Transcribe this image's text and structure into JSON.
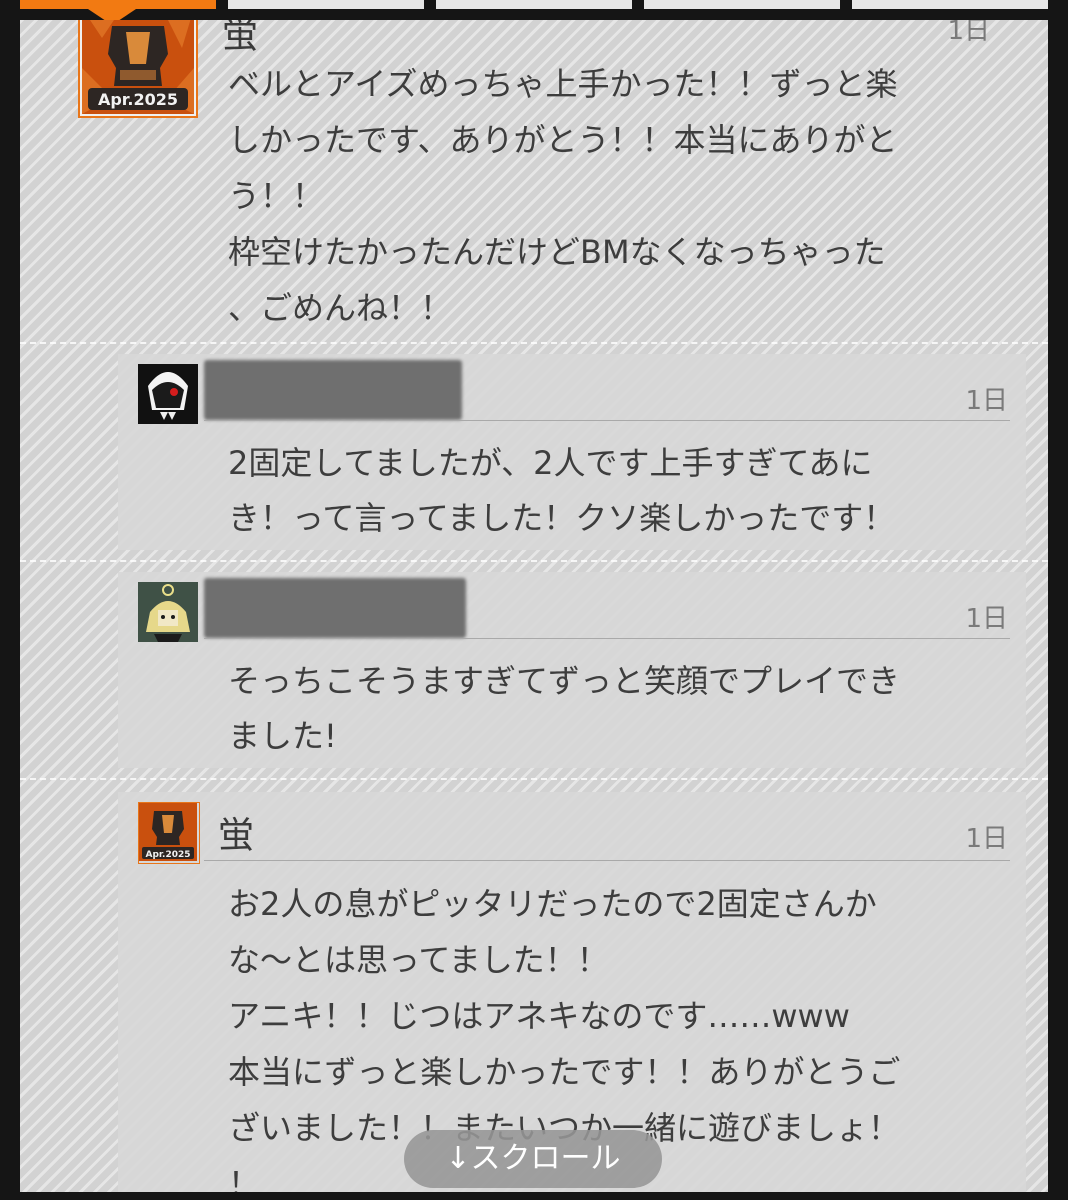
{
  "colors": {
    "accent": "#f27a12",
    "panel_bg": "#d2d2d2",
    "text": "#3d3d3d",
    "time_text": "#7a7a7a"
  },
  "main_post": {
    "name": "蛍",
    "time": "1日",
    "badge": "Apr.2025",
    "text": "ベルとアイズめっちゃ上手かった！！ずっと楽\nしかったです、ありがとう！！本当にありがと\nう！！\n枠空けたかったんだけどBMなくなっちゃった\n、ごめんね！！"
  },
  "replies": [
    {
      "name": "",
      "name_redacted": true,
      "time": "1日",
      "text": "2固定してましたが、2人です上手すぎてあに\nき！って言ってました！クソ楽しかったです！"
    },
    {
      "name": "",
      "name_redacted": true,
      "time": "1日",
      "text": "そっちこそうますぎてずっと笑顔でプレイでき\nました!"
    },
    {
      "name": "蛍",
      "name_redacted": false,
      "time": "1日",
      "badge": "Apr.2025",
      "text": "お2人の息がピッタリだったので2固定さんか\nな〜とは思ってました！！\nアニキ！！じつはアネキなのです……www\n本当にずっと楽しかったです！！ありがとうご\nざいました！！またいつか一緒に遊びましょ！\n！"
    }
  ],
  "scroll_button": {
    "label": "↓スクロール",
    "icon": "arrow-down-icon"
  }
}
